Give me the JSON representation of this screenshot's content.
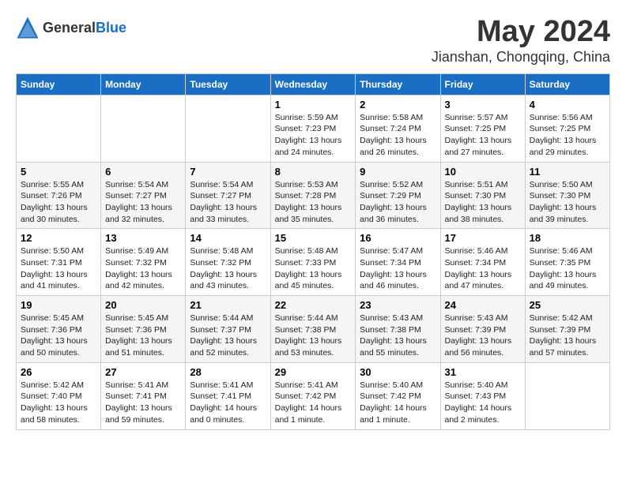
{
  "header": {
    "logo_general": "General",
    "logo_blue": "Blue",
    "month": "May 2024",
    "location": "Jianshan, Chongqing, China"
  },
  "weekdays": [
    "Sunday",
    "Monday",
    "Tuesday",
    "Wednesday",
    "Thursday",
    "Friday",
    "Saturday"
  ],
  "weeks": [
    [
      {
        "day": "",
        "sunrise": "",
        "sunset": "",
        "daylight": ""
      },
      {
        "day": "",
        "sunrise": "",
        "sunset": "",
        "daylight": ""
      },
      {
        "day": "",
        "sunrise": "",
        "sunset": "",
        "daylight": ""
      },
      {
        "day": "1",
        "sunrise": "Sunrise: 5:59 AM",
        "sunset": "Sunset: 7:23 PM",
        "daylight": "Daylight: 13 hours and 24 minutes."
      },
      {
        "day": "2",
        "sunrise": "Sunrise: 5:58 AM",
        "sunset": "Sunset: 7:24 PM",
        "daylight": "Daylight: 13 hours and 26 minutes."
      },
      {
        "day": "3",
        "sunrise": "Sunrise: 5:57 AM",
        "sunset": "Sunset: 7:25 PM",
        "daylight": "Daylight: 13 hours and 27 minutes."
      },
      {
        "day": "4",
        "sunrise": "Sunrise: 5:56 AM",
        "sunset": "Sunset: 7:25 PM",
        "daylight": "Daylight: 13 hours and 29 minutes."
      }
    ],
    [
      {
        "day": "5",
        "sunrise": "Sunrise: 5:55 AM",
        "sunset": "Sunset: 7:26 PM",
        "daylight": "Daylight: 13 hours and 30 minutes."
      },
      {
        "day": "6",
        "sunrise": "Sunrise: 5:54 AM",
        "sunset": "Sunset: 7:27 PM",
        "daylight": "Daylight: 13 hours and 32 minutes."
      },
      {
        "day": "7",
        "sunrise": "Sunrise: 5:54 AM",
        "sunset": "Sunset: 7:27 PM",
        "daylight": "Daylight: 13 hours and 33 minutes."
      },
      {
        "day": "8",
        "sunrise": "Sunrise: 5:53 AM",
        "sunset": "Sunset: 7:28 PM",
        "daylight": "Daylight: 13 hours and 35 minutes."
      },
      {
        "day": "9",
        "sunrise": "Sunrise: 5:52 AM",
        "sunset": "Sunset: 7:29 PM",
        "daylight": "Daylight: 13 hours and 36 minutes."
      },
      {
        "day": "10",
        "sunrise": "Sunrise: 5:51 AM",
        "sunset": "Sunset: 7:30 PM",
        "daylight": "Daylight: 13 hours and 38 minutes."
      },
      {
        "day": "11",
        "sunrise": "Sunrise: 5:50 AM",
        "sunset": "Sunset: 7:30 PM",
        "daylight": "Daylight: 13 hours and 39 minutes."
      }
    ],
    [
      {
        "day": "12",
        "sunrise": "Sunrise: 5:50 AM",
        "sunset": "Sunset: 7:31 PM",
        "daylight": "Daylight: 13 hours and 41 minutes."
      },
      {
        "day": "13",
        "sunrise": "Sunrise: 5:49 AM",
        "sunset": "Sunset: 7:32 PM",
        "daylight": "Daylight: 13 hours and 42 minutes."
      },
      {
        "day": "14",
        "sunrise": "Sunrise: 5:48 AM",
        "sunset": "Sunset: 7:32 PM",
        "daylight": "Daylight: 13 hours and 43 minutes."
      },
      {
        "day": "15",
        "sunrise": "Sunrise: 5:48 AM",
        "sunset": "Sunset: 7:33 PM",
        "daylight": "Daylight: 13 hours and 45 minutes."
      },
      {
        "day": "16",
        "sunrise": "Sunrise: 5:47 AM",
        "sunset": "Sunset: 7:34 PM",
        "daylight": "Daylight: 13 hours and 46 minutes."
      },
      {
        "day": "17",
        "sunrise": "Sunrise: 5:46 AM",
        "sunset": "Sunset: 7:34 PM",
        "daylight": "Daylight: 13 hours and 47 minutes."
      },
      {
        "day": "18",
        "sunrise": "Sunrise: 5:46 AM",
        "sunset": "Sunset: 7:35 PM",
        "daylight": "Daylight: 13 hours and 49 minutes."
      }
    ],
    [
      {
        "day": "19",
        "sunrise": "Sunrise: 5:45 AM",
        "sunset": "Sunset: 7:36 PM",
        "daylight": "Daylight: 13 hours and 50 minutes."
      },
      {
        "day": "20",
        "sunrise": "Sunrise: 5:45 AM",
        "sunset": "Sunset: 7:36 PM",
        "daylight": "Daylight: 13 hours and 51 minutes."
      },
      {
        "day": "21",
        "sunrise": "Sunrise: 5:44 AM",
        "sunset": "Sunset: 7:37 PM",
        "daylight": "Daylight: 13 hours and 52 minutes."
      },
      {
        "day": "22",
        "sunrise": "Sunrise: 5:44 AM",
        "sunset": "Sunset: 7:38 PM",
        "daylight": "Daylight: 13 hours and 53 minutes."
      },
      {
        "day": "23",
        "sunrise": "Sunrise: 5:43 AM",
        "sunset": "Sunset: 7:38 PM",
        "daylight": "Daylight: 13 hours and 55 minutes."
      },
      {
        "day": "24",
        "sunrise": "Sunrise: 5:43 AM",
        "sunset": "Sunset: 7:39 PM",
        "daylight": "Daylight: 13 hours and 56 minutes."
      },
      {
        "day": "25",
        "sunrise": "Sunrise: 5:42 AM",
        "sunset": "Sunset: 7:39 PM",
        "daylight": "Daylight: 13 hours and 57 minutes."
      }
    ],
    [
      {
        "day": "26",
        "sunrise": "Sunrise: 5:42 AM",
        "sunset": "Sunset: 7:40 PM",
        "daylight": "Daylight: 13 hours and 58 minutes."
      },
      {
        "day": "27",
        "sunrise": "Sunrise: 5:41 AM",
        "sunset": "Sunset: 7:41 PM",
        "daylight": "Daylight: 13 hours and 59 minutes."
      },
      {
        "day": "28",
        "sunrise": "Sunrise: 5:41 AM",
        "sunset": "Sunset: 7:41 PM",
        "daylight": "Daylight: 14 hours and 0 minutes."
      },
      {
        "day": "29",
        "sunrise": "Sunrise: 5:41 AM",
        "sunset": "Sunset: 7:42 PM",
        "daylight": "Daylight: 14 hours and 1 minute."
      },
      {
        "day": "30",
        "sunrise": "Sunrise: 5:40 AM",
        "sunset": "Sunset: 7:42 PM",
        "daylight": "Daylight: 14 hours and 1 minute."
      },
      {
        "day": "31",
        "sunrise": "Sunrise: 5:40 AM",
        "sunset": "Sunset: 7:43 PM",
        "daylight": "Daylight: 14 hours and 2 minutes."
      },
      {
        "day": "",
        "sunrise": "",
        "sunset": "",
        "daylight": ""
      }
    ]
  ]
}
